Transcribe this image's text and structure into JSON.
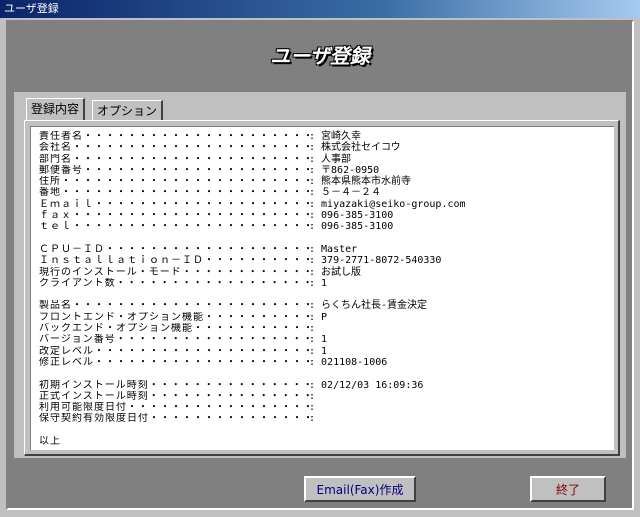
{
  "window": {
    "title": "ユーザ登録"
  },
  "header": {
    "title": "ユーザ登録"
  },
  "tabs": [
    {
      "label": "登録内容"
    },
    {
      "label": "オプション"
    }
  ],
  "report": {
    "g1": [
      {
        "label": "責任者名・・・・・・・・・・・・・・・・・・・・・・",
        "value": ": 宮崎久幸"
      },
      {
        "label": "会社名・・・・・・・・・・・・・・・・・・・・・・・",
        "value": ": 株式会社セイコウ"
      },
      {
        "label": "部門名・・・・・・・・・・・・・・・・・・・・・・・",
        "value": ": 人事部"
      },
      {
        "label": "郵便番号・・・・・・・・・・・・・・・・・・・・・・",
        "value": ": 〒862-0950"
      },
      {
        "label": "住所・・・・・・・・・・・・・・・・・・・・・・・・",
        "value": ": 熊本県熊本市水前寺"
      },
      {
        "label": "番地・・・・・・・・・・・・・・・・・・・・・・・・",
        "value": ": ５－４－２４"
      },
      {
        "label": "Ｅｍａｉｌ・・・・・・・・・・・・・・・・・・・・・",
        "value": ": miyazaki@seiko-group.com"
      },
      {
        "label": "ｆａｘ・・・・・・・・・・・・・・・・・・・・・・・",
        "value": ": 096-385-3100"
      },
      {
        "label": "ｔｅｌ・・・・・・・・・・・・・・・・・・・・・・・",
        "value": ": 096-385-3100"
      }
    ],
    "g2": [
      {
        "label": "ＣＰＵ－ＩＤ・・・・・・・・・・・・・・・・・・・・",
        "value": ": Master"
      },
      {
        "label": "Ｉｎｓｔａｌｌａｔｉｏｎ－ＩＤ・・・・・・・・・・・",
        "value": ": 379-2771-8072-540330"
      },
      {
        "label": "現行のインストール・モード・・・・・・・・・・・・・",
        "value": ": お試し版"
      },
      {
        "label": "クライアント数・・・・・・・・・・・・・・・・・・・",
        "value": ": 1"
      }
    ],
    "g3": [
      {
        "label": "製品名・・・・・・・・・・・・・・・・・・・・・・・",
        "value": ": らくちん社長-賃金決定"
      },
      {
        "label": "フロントエンド・オプション機能・・・・・・・・・・・",
        "value": ": P"
      },
      {
        "label": "バックエンド・オプション機能・・・・・・・・・・・・",
        "value": ":"
      },
      {
        "label": "バージョン番号・・・・・・・・・・・・・・・・・・・",
        "value": ": 1"
      },
      {
        "label": "改定レベル・・・・・・・・・・・・・・・・・・・・・",
        "value": ": 1"
      },
      {
        "label": "修正レベル・・・・・・・・・・・・・・・・・・・・・",
        "value": ": 021108-1006"
      }
    ],
    "g4": [
      {
        "label": "初期インストール時刻・・・・・・・・・・・・・・・・",
        "value": ": 02/12/03 16:09:36"
      },
      {
        "label": "正式インストール時刻・・・・・・・・・・・・・・・・",
        "value": ":"
      },
      {
        "label": "利用可能限度日付・・・・・・・・・・・・・・・・・・",
        "value": ":"
      },
      {
        "label": "保守契約有効限度日付・・・・・・・・・・・・・・・・",
        "value": ":"
      }
    ],
    "closing": "以上"
  },
  "buttons": {
    "email": "Email(Fax)作成",
    "exit": "終了"
  }
}
